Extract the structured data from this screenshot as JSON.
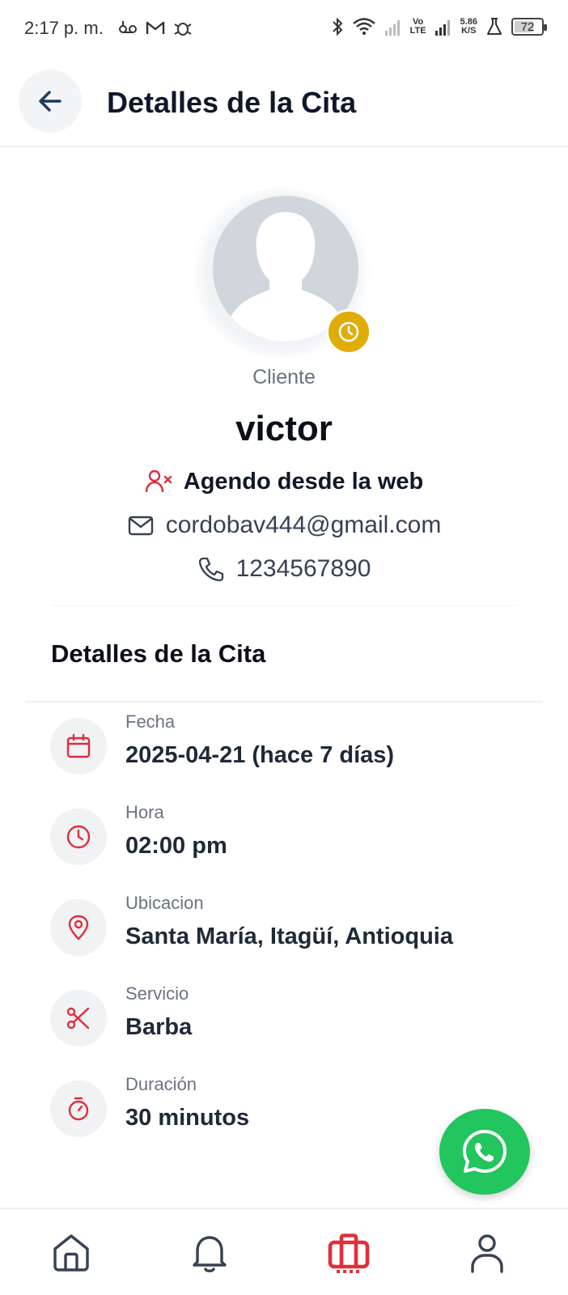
{
  "status_bar": {
    "time": "2:17 p. m.",
    "volte": [
      "Vo",
      "LTE"
    ],
    "net_speed": [
      "5.86",
      "K/S"
    ],
    "battery": "72",
    "battery_level": 0.72,
    "left_icons": [
      "voicemail-icon",
      "gmail-icon",
      "bug-icon"
    ],
    "right_icons": [
      "bluetooth-icon",
      "wifi-icon",
      "signal-icon",
      "signal-icon",
      "flask-icon"
    ]
  },
  "app_bar": {
    "back_icon": "arrow-left-icon",
    "title": "Detalles de la Cita"
  },
  "profile": {
    "label": "Cliente",
    "name": "victor",
    "status_icon": "clock-icon",
    "status_color": "#e0ac08",
    "source_icon": "user-x-icon",
    "source": "Agendo desde la web",
    "email_icon": "mail-icon",
    "email": "cordobav444@gmail.com",
    "phone_icon": "phone-icon",
    "phone": "1234567890"
  },
  "details": {
    "title": "Detalles de la Cita",
    "items": [
      {
        "icon": "calendar-icon",
        "label": "Fecha",
        "value": "2025-04-21 (hace 7 días)"
      },
      {
        "icon": "clock-icon",
        "label": "Hora",
        "value": "02:00 pm"
      },
      {
        "icon": "map-pin-icon",
        "label": "Ubicacion",
        "value": "Santa María, Itagüí, Antioquia"
      },
      {
        "icon": "scissors-icon",
        "label": "Servicio",
        "value": "Barba"
      },
      {
        "icon": "timer-icon",
        "label": "Duración",
        "value": "30 minutos"
      }
    ]
  },
  "fab": {
    "icon": "whatsapp-icon",
    "color": "#22c55e"
  },
  "bottom_nav": {
    "items": [
      {
        "icon": "home-icon",
        "active": false
      },
      {
        "icon": "bell-icon",
        "active": false
      },
      {
        "icon": "briefcase-icon",
        "active": true
      },
      {
        "icon": "user-icon",
        "active": false
      }
    ],
    "active_color": "#e0303a",
    "inactive_color": "#374151"
  },
  "colors": {
    "accent": "#dc2f3c",
    "text_primary": "#0b0f19",
    "text_muted": "#6b7280"
  }
}
